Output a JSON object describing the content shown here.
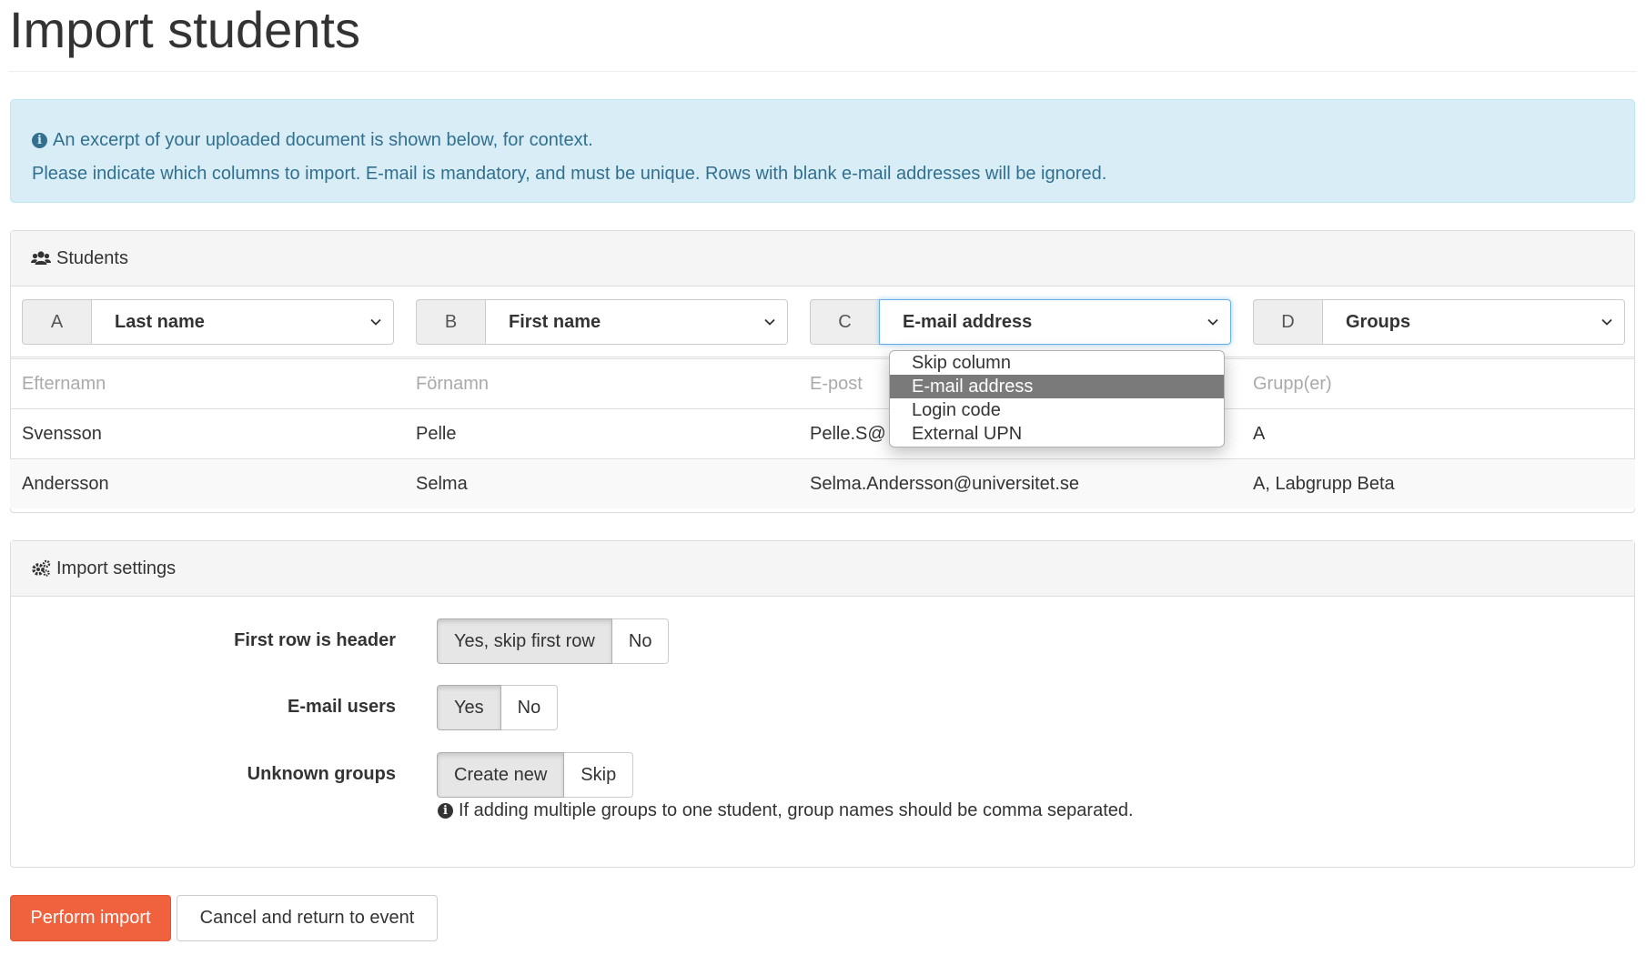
{
  "page": {
    "title": "Import students"
  },
  "alert": {
    "line1": "An excerpt of your uploaded document is shown below, for context.",
    "line2": "Please indicate which columns to import. E-mail is mandatory, and must be unique. Rows with blank e-mail addresses will be ignored."
  },
  "students_panel": {
    "heading": "Students",
    "icon": "users-icon",
    "columns": [
      {
        "letter": "A",
        "selected": "Last name"
      },
      {
        "letter": "B",
        "selected": "First name"
      },
      {
        "letter": "C",
        "selected": "E-mail address"
      },
      {
        "letter": "D",
        "selected": "Groups"
      }
    ],
    "dropdown_options": [
      "Skip column",
      "E-mail address",
      "Login code",
      "External UPN"
    ],
    "dropdown_selected": "E-mail address",
    "header_row": [
      "Efternamn",
      "Förnamn",
      "E-post",
      "Grupp(er)"
    ],
    "rows": [
      [
        "Svensson",
        "Pelle",
        "Pelle.S@",
        "A"
      ],
      [
        "Andersson",
        "Selma",
        "Selma.Andersson@universitet.se",
        "A, Labgrupp Beta"
      ]
    ]
  },
  "settings_panel": {
    "heading": "Import settings",
    "icon": "cogs-icon",
    "first_row_header": {
      "label": "First row is header",
      "options": [
        "Yes, skip first row",
        "No"
      ],
      "active": "Yes, skip first row"
    },
    "email_users": {
      "label": "E-mail users",
      "options": [
        "Yes",
        "No"
      ],
      "active": "Yes"
    },
    "unknown_groups": {
      "label": "Unknown groups",
      "options": [
        "Create new",
        "Skip"
      ],
      "active": "Create new"
    },
    "help_text": "If adding multiple groups to one student, group names should be comma separated."
  },
  "actions": {
    "perform_import": "Perform import",
    "cancel": "Cancel and return to event"
  },
  "colors": {
    "primary": "#f0613d",
    "info_bg": "#d9edf7",
    "info_text": "#31708f",
    "dropdown_highlight": "#7a7a7a"
  }
}
